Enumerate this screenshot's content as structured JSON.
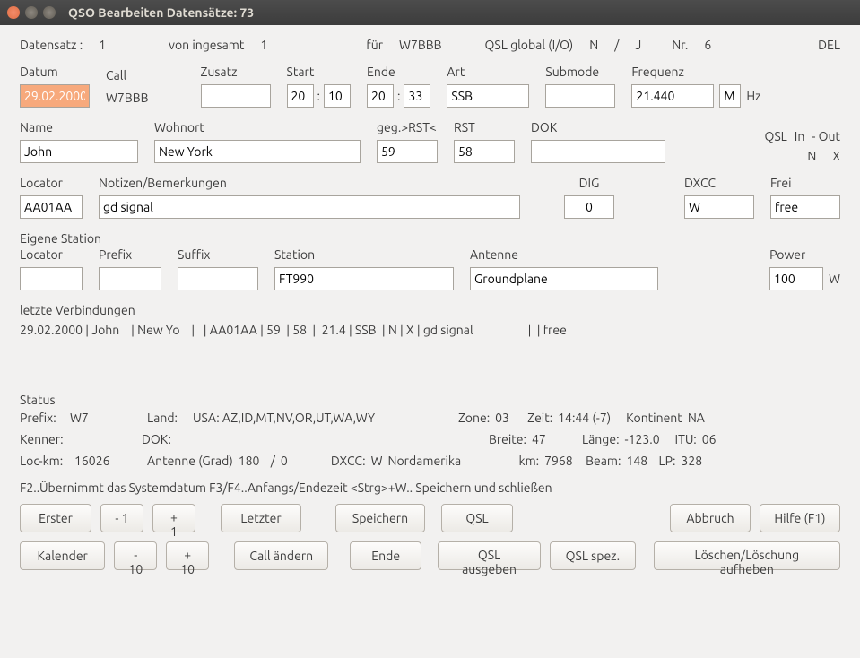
{
  "title": "QSO Bearbeiten  Datensätze: 73",
  "header": {
    "datensatz_lbl": "Datensatz :",
    "datensatz": "1",
    "von_lbl": "von ingesamt",
    "von": "1",
    "fuer_lbl": "für",
    "fuer": "W7BBB",
    "qslg_lbl": "QSL global (I/O)",
    "qslg_i": "N",
    "qslg_sep": "/",
    "qslg_o": "J",
    "nr_lbl": "Nr.",
    "nr": "6",
    "del_lbl": "DEL"
  },
  "f": {
    "datum_lbl": "Datum",
    "datum": "29.02.2000",
    "call_lbl": "Call",
    "call": "W7BBB",
    "zusatz_lbl": "Zusatz",
    "zusatz": "",
    "start_lbl": "Start",
    "start_h": "20",
    "start_m": "10",
    "ende_lbl": "Ende",
    "ende_h": "20",
    "ende_m": "33",
    "art_lbl": "Art",
    "art": "SSB",
    "submode_lbl": "Submode",
    "submode": "",
    "freq_lbl": "Frequenz",
    "freq": "21.440",
    "freq_unit": "M",
    "hz": "Hz",
    "name_lbl": "Name",
    "name": "John",
    "wohnort_lbl": "Wohnort",
    "wohnort": "New York",
    "rst_geg_lbl": "geg.>RST<",
    "rst_geg": "59",
    "rst_lbl": "RST",
    "rst": "58",
    "dok_lbl": "DOK",
    "dok": "",
    "qsl_lbl": "QSL",
    "qsl_in_lbl": "In",
    "qsl_out_lbl": "- Out",
    "qsl_in": "N",
    "qsl_out": "X",
    "locator_lbl": "Locator",
    "locator": "AA01AA",
    "notizen_lbl": "Notizen/Bemerkungen",
    "notizen": "gd signal",
    "dig_lbl": "DIG",
    "dig": "0",
    "dxcc_lbl": "DXCC",
    "dxcc": "W",
    "frei_lbl": "Frei",
    "frei": "free"
  },
  "own": {
    "title": "Eigene Station",
    "locator_lbl": "Locator",
    "locator": "",
    "prefix_lbl": "Prefix",
    "prefix": "",
    "suffix_lbl": "Suffix",
    "suffix": "",
    "station_lbl": "Station",
    "station": "FT990",
    "antenne_lbl": "Antenne",
    "antenne": "Groundplane",
    "power_lbl": "Power",
    "power": "100",
    "power_unit": "W"
  },
  "history": {
    "title": "letzte Verbindungen",
    "line": "29.02.2000 | John    | New Yo    |   | AA01AA | 59  | 58  |  21.4 | SSB  | N | X | gd signal                   |  | free"
  },
  "status": {
    "title": "Status",
    "prefix_lbl": "Prefix:",
    "prefix": "W7",
    "land_lbl": "Land:",
    "land": "USA: AZ,ID,MT,NV,OR,UT,WA,WY",
    "zone_lbl": "Zone:",
    "zone": "03",
    "zeit_lbl": "Zeit:",
    "zeit": "14:44 (-7)",
    "kontinent_lbl": "Kontinent",
    "kontinent": "NA",
    "kenner_lbl": "Kenner:",
    "kenner": "",
    "dok_lbl": "DOK:",
    "dok": "",
    "breite_lbl": "Breite:",
    "breite": "47",
    "laenge_lbl": "Länge:",
    "laenge": "-123.0",
    "itu_lbl": "ITU:",
    "itu": "06",
    "lockm_lbl": "Loc-km:",
    "lockm": "16026",
    "ant_lbl": "Antenne (Grad)",
    "ant_a": "180",
    "ant_sep": "/",
    "ant_b": "0",
    "dxcc_lbl": "DXCC:",
    "dxcc": "W",
    "dxcc_region": "Nordamerika",
    "km_lbl": "km:",
    "km": "7968",
    "beam_lbl": "Beam:",
    "beam": "148",
    "lp_lbl": "LP:",
    "lp": "328"
  },
  "hint": "F2..Übernimmt das Systemdatum     F3/F4..Anfangs/Endezeit <Strg>+W.. Speichern und schließen",
  "buttons": {
    "erster": "Erster",
    "m1": "- 1",
    "p1": "+ 1",
    "letzter": "Letzter",
    "speichern": "Speichern",
    "qsl": "QSL",
    "abbruch": "Abbruch",
    "hilfe": "Hilfe (F1)",
    "kalender": "Kalender",
    "m10": "- 10",
    "p10": "+ 10",
    "call_aendern": "Call ändern",
    "ende": "Ende",
    "qsl_ausgeben": "QSL ausgeben",
    "qsl_spez": "QSL spez.",
    "loeschen": "Löschen/Löschung aufheben"
  }
}
